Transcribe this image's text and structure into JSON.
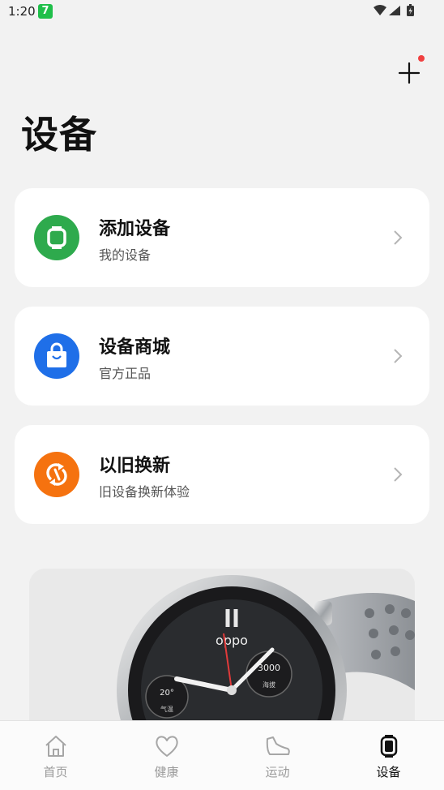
{
  "status_bar": {
    "time": "1:20",
    "app_badge": "7"
  },
  "header": {
    "title": "设备",
    "add_icon": "plus-icon"
  },
  "cards": [
    {
      "title": "添加设备",
      "subtitle": "我的设备",
      "icon": "watch-icon",
      "icon_color": "#2eaa4d"
    },
    {
      "title": "设备商城",
      "subtitle": "官方正品",
      "icon": "shopping-bag-icon",
      "icon_color": "#1f6fe8"
    },
    {
      "title": "以旧换新",
      "subtitle": "旧设备换新体验",
      "icon": "exchange-icon",
      "icon_color": "#f5720f"
    }
  ],
  "promo": {
    "brand": "oppo",
    "dial_text_top": "3000",
    "dial_label_top": "海拔",
    "dial_text_left": "20°",
    "dial_label_left": "气温"
  },
  "bottom_nav": [
    {
      "label": "首页",
      "icon": "home-icon"
    },
    {
      "label": "健康",
      "icon": "heart-icon"
    },
    {
      "label": "运动",
      "icon": "shoe-icon"
    },
    {
      "label": "设备",
      "icon": "watch-icon"
    }
  ],
  "colors": {
    "accent_green": "#2eaa4d",
    "accent_blue": "#1f6fe8",
    "accent_orange": "#f5720f",
    "notify_red": "#f04040"
  }
}
